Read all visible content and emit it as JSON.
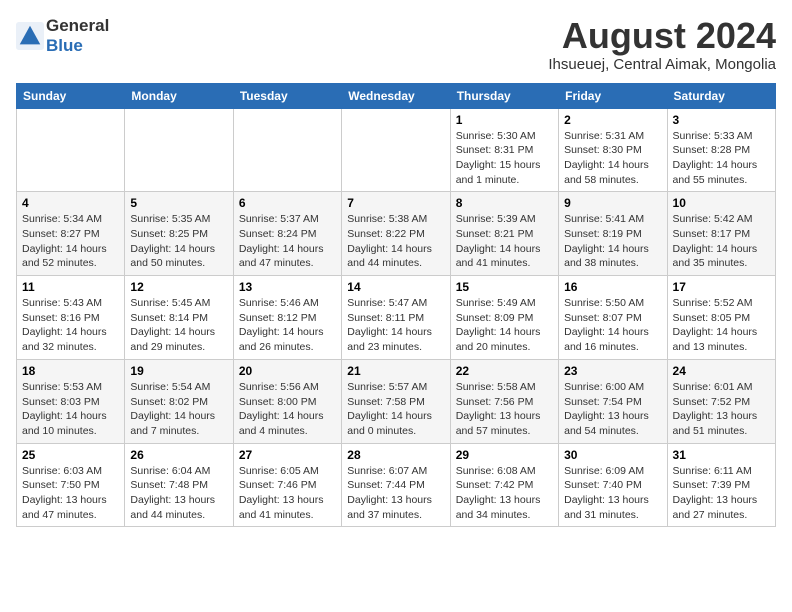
{
  "header": {
    "logo_general": "General",
    "logo_blue": "Blue",
    "month_year": "August 2024",
    "location": "Ihsueuej, Central Aimak, Mongolia"
  },
  "weekdays": [
    "Sunday",
    "Monday",
    "Tuesday",
    "Wednesday",
    "Thursday",
    "Friday",
    "Saturday"
  ],
  "weeks": [
    [
      {
        "day": "",
        "info": ""
      },
      {
        "day": "",
        "info": ""
      },
      {
        "day": "",
        "info": ""
      },
      {
        "day": "",
        "info": ""
      },
      {
        "day": "1",
        "info": "Sunrise: 5:30 AM\nSunset: 8:31 PM\nDaylight: 15 hours\nand 1 minute."
      },
      {
        "day": "2",
        "info": "Sunrise: 5:31 AM\nSunset: 8:30 PM\nDaylight: 14 hours\nand 58 minutes."
      },
      {
        "day": "3",
        "info": "Sunrise: 5:33 AM\nSunset: 8:28 PM\nDaylight: 14 hours\nand 55 minutes."
      }
    ],
    [
      {
        "day": "4",
        "info": "Sunrise: 5:34 AM\nSunset: 8:27 PM\nDaylight: 14 hours\nand 52 minutes."
      },
      {
        "day": "5",
        "info": "Sunrise: 5:35 AM\nSunset: 8:25 PM\nDaylight: 14 hours\nand 50 minutes."
      },
      {
        "day": "6",
        "info": "Sunrise: 5:37 AM\nSunset: 8:24 PM\nDaylight: 14 hours\nand 47 minutes."
      },
      {
        "day": "7",
        "info": "Sunrise: 5:38 AM\nSunset: 8:22 PM\nDaylight: 14 hours\nand 44 minutes."
      },
      {
        "day": "8",
        "info": "Sunrise: 5:39 AM\nSunset: 8:21 PM\nDaylight: 14 hours\nand 41 minutes."
      },
      {
        "day": "9",
        "info": "Sunrise: 5:41 AM\nSunset: 8:19 PM\nDaylight: 14 hours\nand 38 minutes."
      },
      {
        "day": "10",
        "info": "Sunrise: 5:42 AM\nSunset: 8:17 PM\nDaylight: 14 hours\nand 35 minutes."
      }
    ],
    [
      {
        "day": "11",
        "info": "Sunrise: 5:43 AM\nSunset: 8:16 PM\nDaylight: 14 hours\nand 32 minutes."
      },
      {
        "day": "12",
        "info": "Sunrise: 5:45 AM\nSunset: 8:14 PM\nDaylight: 14 hours\nand 29 minutes."
      },
      {
        "day": "13",
        "info": "Sunrise: 5:46 AM\nSunset: 8:12 PM\nDaylight: 14 hours\nand 26 minutes."
      },
      {
        "day": "14",
        "info": "Sunrise: 5:47 AM\nSunset: 8:11 PM\nDaylight: 14 hours\nand 23 minutes."
      },
      {
        "day": "15",
        "info": "Sunrise: 5:49 AM\nSunset: 8:09 PM\nDaylight: 14 hours\nand 20 minutes."
      },
      {
        "day": "16",
        "info": "Sunrise: 5:50 AM\nSunset: 8:07 PM\nDaylight: 14 hours\nand 16 minutes."
      },
      {
        "day": "17",
        "info": "Sunrise: 5:52 AM\nSunset: 8:05 PM\nDaylight: 14 hours\nand 13 minutes."
      }
    ],
    [
      {
        "day": "18",
        "info": "Sunrise: 5:53 AM\nSunset: 8:03 PM\nDaylight: 14 hours\nand 10 minutes."
      },
      {
        "day": "19",
        "info": "Sunrise: 5:54 AM\nSunset: 8:02 PM\nDaylight: 14 hours\nand 7 minutes."
      },
      {
        "day": "20",
        "info": "Sunrise: 5:56 AM\nSunset: 8:00 PM\nDaylight: 14 hours\nand 4 minutes."
      },
      {
        "day": "21",
        "info": "Sunrise: 5:57 AM\nSunset: 7:58 PM\nDaylight: 14 hours\nand 0 minutes."
      },
      {
        "day": "22",
        "info": "Sunrise: 5:58 AM\nSunset: 7:56 PM\nDaylight: 13 hours\nand 57 minutes."
      },
      {
        "day": "23",
        "info": "Sunrise: 6:00 AM\nSunset: 7:54 PM\nDaylight: 13 hours\nand 54 minutes."
      },
      {
        "day": "24",
        "info": "Sunrise: 6:01 AM\nSunset: 7:52 PM\nDaylight: 13 hours\nand 51 minutes."
      }
    ],
    [
      {
        "day": "25",
        "info": "Sunrise: 6:03 AM\nSunset: 7:50 PM\nDaylight: 13 hours\nand 47 minutes."
      },
      {
        "day": "26",
        "info": "Sunrise: 6:04 AM\nSunset: 7:48 PM\nDaylight: 13 hours\nand 44 minutes."
      },
      {
        "day": "27",
        "info": "Sunrise: 6:05 AM\nSunset: 7:46 PM\nDaylight: 13 hours\nand 41 minutes."
      },
      {
        "day": "28",
        "info": "Sunrise: 6:07 AM\nSunset: 7:44 PM\nDaylight: 13 hours\nand 37 minutes."
      },
      {
        "day": "29",
        "info": "Sunrise: 6:08 AM\nSunset: 7:42 PM\nDaylight: 13 hours\nand 34 minutes."
      },
      {
        "day": "30",
        "info": "Sunrise: 6:09 AM\nSunset: 7:40 PM\nDaylight: 13 hours\nand 31 minutes."
      },
      {
        "day": "31",
        "info": "Sunrise: 6:11 AM\nSunset: 7:39 PM\nDaylight: 13 hours\nand 27 minutes."
      }
    ]
  ]
}
